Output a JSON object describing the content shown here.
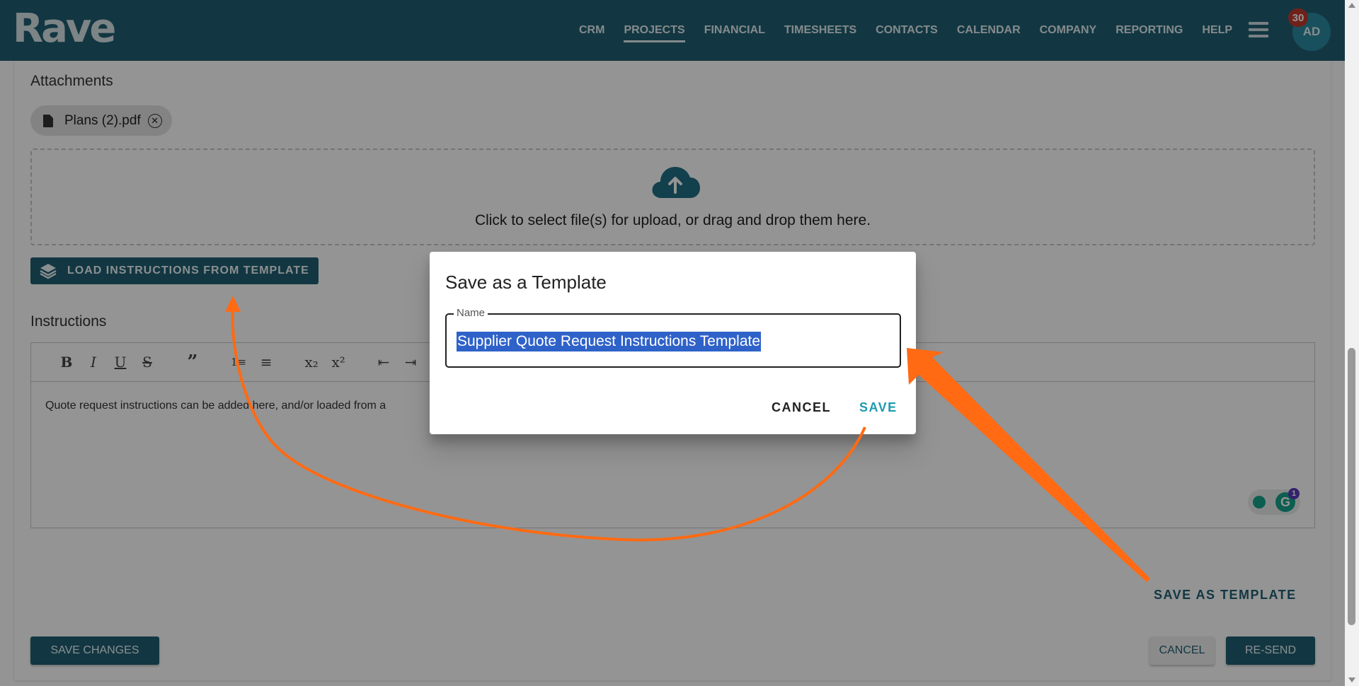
{
  "header": {
    "logo": "Rave",
    "nav": [
      "CRM",
      "PROJECTS",
      "FINANCIAL",
      "TIMESHEETS",
      "CONTACTS",
      "CALENDAR",
      "COMPANY",
      "REPORTING",
      "HELP"
    ],
    "active_nav": "PROJECTS",
    "notification_count": "30",
    "avatar_initials": "AD",
    "hamburger_icon": "menu-icon"
  },
  "attachments": {
    "label": "Attachments",
    "files": [
      {
        "name": "Plans (2).pdf",
        "icon": "file-icon"
      }
    ],
    "dropzone_text": "Click to select file(s) for upload, or drag and drop them here.",
    "upload_icon": "cloud-upload-icon"
  },
  "load_template_button": "LOAD INSTRUCTIONS FROM TEMPLATE",
  "instructions": {
    "label": "Instructions",
    "toolbar": [
      "B",
      "I",
      "U",
      "S",
      "”",
      "1≡",
      "≡",
      "x₂",
      "x²",
      "⇤",
      "⇥"
    ],
    "content": "Quote request instructions can be added here, and/or loaded from a"
  },
  "grammarly": {
    "count": "1"
  },
  "save_as_template_link": "SAVE AS TEMPLATE",
  "footer": {
    "save_changes": "SAVE CHANGES",
    "cancel": "CANCEL",
    "resend": "RE-SEND"
  },
  "dialog": {
    "title": "Save as a Template",
    "field_label": "Name",
    "field_value": "Supplier Quote Request Instructions Template",
    "cancel": "CANCEL",
    "save": "SAVE"
  },
  "colors": {
    "brand": "#1f5f73",
    "accent": "#1d9bb0",
    "annotation_arrow": "#ff6a13",
    "selection": "#2f62c9"
  }
}
